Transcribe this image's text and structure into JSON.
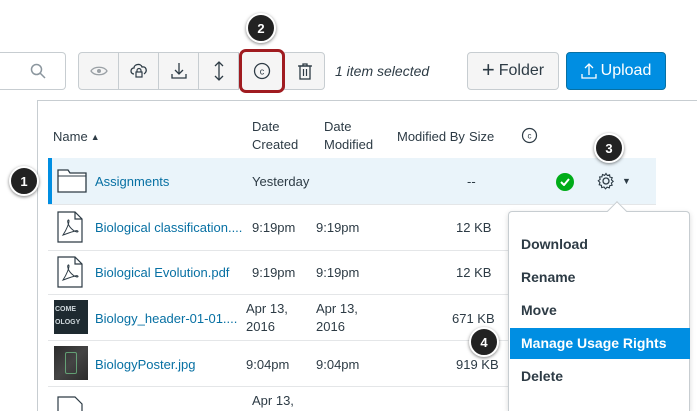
{
  "toolbar": {
    "selected_text": "1 item selected",
    "folder_label": "Folder",
    "upload_label": "Upload",
    "icons": [
      "search-icon",
      "preview-icon",
      "cloud-lock-icon",
      "download-icon",
      "move-icon",
      "copyright-icon",
      "trash-icon"
    ]
  },
  "table": {
    "headers": {
      "name": "Name",
      "date_created": [
        "Date",
        "Created"
      ],
      "date_modified": [
        "Date",
        "Modified"
      ],
      "modified_by": "Modified By",
      "size": "Size"
    },
    "rows": [
      {
        "name": "Assignments",
        "created": "Yesterday",
        "modified": "",
        "size": "--",
        "type": "folder"
      },
      {
        "name": "Biological classification....",
        "created": "9:19pm",
        "modified": "9:19pm",
        "size": "12 KB",
        "type": "pdf"
      },
      {
        "name": "Biological Evolution.pdf",
        "created": "9:19pm",
        "modified": "9:19pm",
        "size": "12 KB",
        "type": "pdf"
      },
      {
        "name": "Biology_header-01-01....",
        "created": [
          "Apr 13,",
          "2016"
        ],
        "modified": [
          "Apr 13,",
          "2016"
        ],
        "size": "671 KB",
        "type": "image"
      },
      {
        "name": "BiologyPoster.jpg",
        "created": "9:04pm",
        "modified": "9:04pm",
        "size": "919 KB",
        "type": "image"
      },
      {
        "name": "",
        "created": "Apr 13,",
        "modified": "",
        "size": "",
        "type": "pdf"
      }
    ]
  },
  "menu": {
    "items": [
      "Download",
      "Rename",
      "Move",
      "Manage Usage Rights",
      "Delete"
    ],
    "active_index": 3
  },
  "thumb_text": [
    "COME",
    "OLOGY"
  ],
  "callouts": [
    "1",
    "2",
    "3",
    "4"
  ],
  "colors": {
    "accent": "#008ee2",
    "highlight": "#a01b20",
    "published": "#00ac18",
    "link": "#0770a3"
  }
}
